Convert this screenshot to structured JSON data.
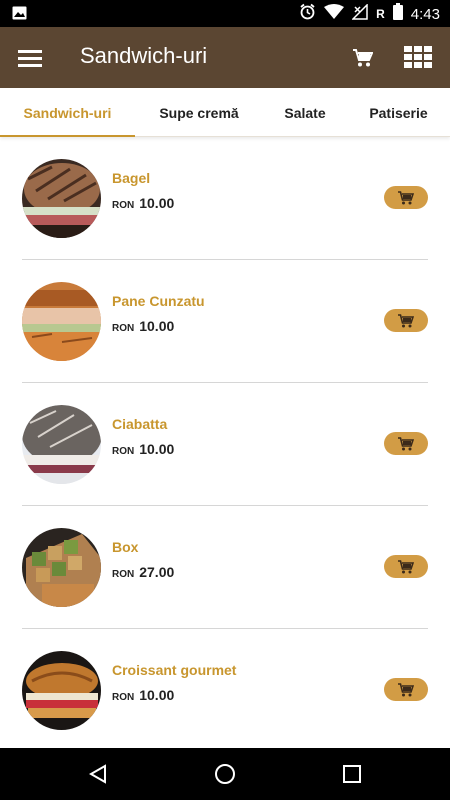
{
  "status_bar": {
    "time": "4:43",
    "roaming_label": "R",
    "icons": [
      "image-icon",
      "alarm-icon",
      "wifi-icon",
      "signal-icon",
      "battery-icon"
    ]
  },
  "app_bar": {
    "title": "Sandwich-uri",
    "menu_icon": "menu-icon",
    "cart_icon": "cart-icon",
    "grid_icon": "grid-icon"
  },
  "tabs": [
    {
      "label": "Sandwich-uri",
      "active": true
    },
    {
      "label": "Supe cremă",
      "active": false
    },
    {
      "label": "Salate",
      "active": false
    },
    {
      "label": "Patiserie",
      "active": false
    }
  ],
  "products": [
    {
      "name": "Bagel",
      "currency": "RON",
      "price": "10.00"
    },
    {
      "name": "Pane Cunzatu",
      "currency": "RON",
      "price": "10.00"
    },
    {
      "name": "Ciabatta",
      "currency": "RON",
      "price": "10.00"
    },
    {
      "name": "Box",
      "currency": "RON",
      "price": "27.00"
    },
    {
      "name": "Croissant gourmet",
      "currency": "RON",
      "price": "10.00"
    }
  ],
  "colors": {
    "app_bar": "#5b4632",
    "accent": "#c8962e",
    "button": "#d29c45"
  },
  "nav_bar": {
    "icons": [
      "back-icon",
      "home-icon",
      "recents-icon"
    ]
  }
}
